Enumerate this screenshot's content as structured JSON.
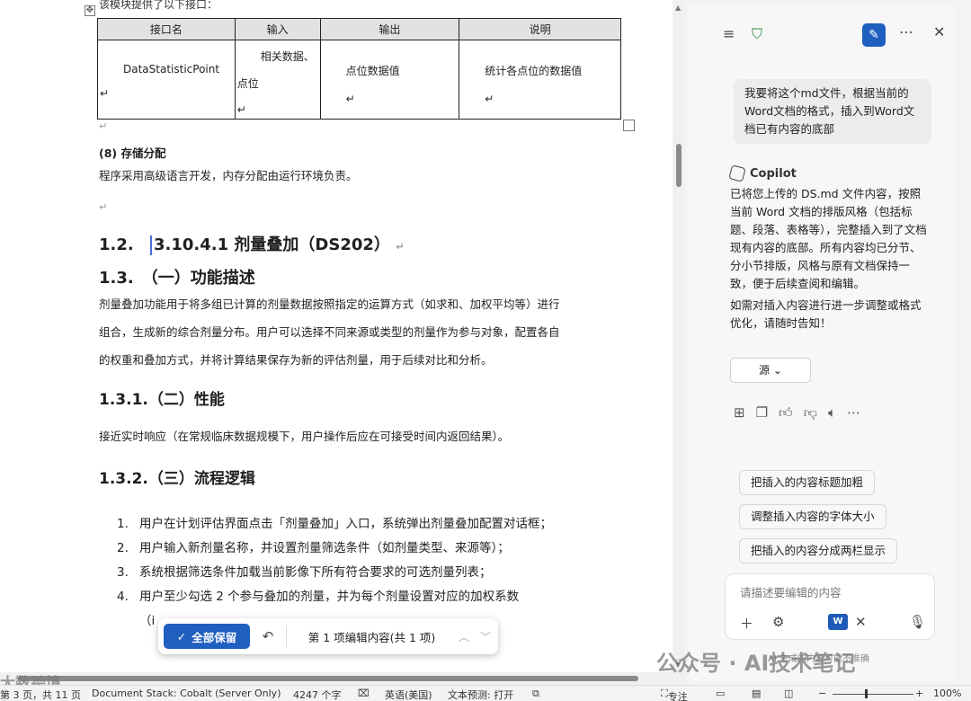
{
  "document": {
    "intro_text": "该模块提供了以下接口：",
    "table": {
      "headers": [
        "接口名",
        "输入",
        "输出",
        "说明"
      ],
      "row": {
        "name": "DataStatisticPoint",
        "input_line1": "相关数据、",
        "input_line2": "点位",
        "output": "点位数据值",
        "desc": "统计各点位的数据值"
      }
    },
    "storage_heading": "(8) 存储分配",
    "storage_text": "程序采用高级语言开发，内存分配由运行环境负责。",
    "heading_12_num": "1.2.",
    "heading_12_text": "3.10.4.1 剂量叠加（DS202）",
    "heading_13": "1.3.　（一）功能描述",
    "func_lines": [
      "剂量叠加功能用于将多组已计算的剂量数据按照指定的运算方式（如求和、加权平均等）进行",
      "组合，生成新的综合剂量分布。用户可以选择不同来源或类型的剂量作为参与对象，配置各自",
      "的权重和叠加方式，并将计算结果保存为新的评估剂量，用于后续对比和分析。"
    ],
    "heading_131": "1.3.1.（二）性能",
    "perf_text": "接近实时响应（在常规临床数据规模下，用户操作后应在可接受时间内返回结果）。",
    "heading_132": "1.3.2.（三）流程逻辑",
    "steps": [
      {
        "num": "1.",
        "text": "用户在计划评估界面点击「剂量叠加」入口，系统弹出剂量叠加配置对话框；"
      },
      {
        "num": "2.",
        "text": "用户输入新剂量名称，并设置剂量筛选条件（如剂量类型、来源等）；"
      },
      {
        "num": "3.",
        "text": "系统根据筛选条件加载当前影像下所有符合要求的可选剂量列表；"
      },
      {
        "num": "4.",
        "text": "用户至少勾选 2 个参与叠加的剂量，并为每个剂量设置对应的加权系数"
      }
    ],
    "step5_fragment": "（i"
  },
  "accept_bar": {
    "keep_all": "全部保留",
    "edit_count": "第 1 项编辑内容(共 1 项)"
  },
  "copilot": {
    "user_message": "我要将这个md文件，根据当前的Word文档的格式，插入到Word文档已有内容的底部",
    "assistant_name": "Copilot",
    "reply_p1": "已将您上传的 DS.md 文件内容，按照当前 Word 文档的排版风格（包括标题、段落、表格等），完整插入到了文档现有内容的底部。所有内容均已分节、分小节排版，风格与原有文档保持一致，便于后续查阅和编辑。",
    "reply_p2": "如需对插入内容进行进一步调整或格式优化，请随时告知！",
    "source_button": "源",
    "suggestions": [
      "把插入的内容标题加粗",
      "调整插入内容的字体大小",
      "把插入的内容分成两栏显示"
    ],
    "composer_placeholder": "请描述要编辑的内容",
    "disclaimer": "AI 生成的内容可能不准确"
  },
  "watermarks": {
    "left": "大数跨境",
    "right": "公众号 · AI技术笔记"
  },
  "status_bar": {
    "page": "第 3 页，共 11 页",
    "doc_stack": "Document Stack: Cobalt (Server Only)",
    "word_count": "4247 个字",
    "language": "英语(美国)",
    "prediction": "文本预测: 打开",
    "focus": "专注",
    "zoom": "100%"
  },
  "colors": {
    "accent": "#1f5fbf"
  }
}
